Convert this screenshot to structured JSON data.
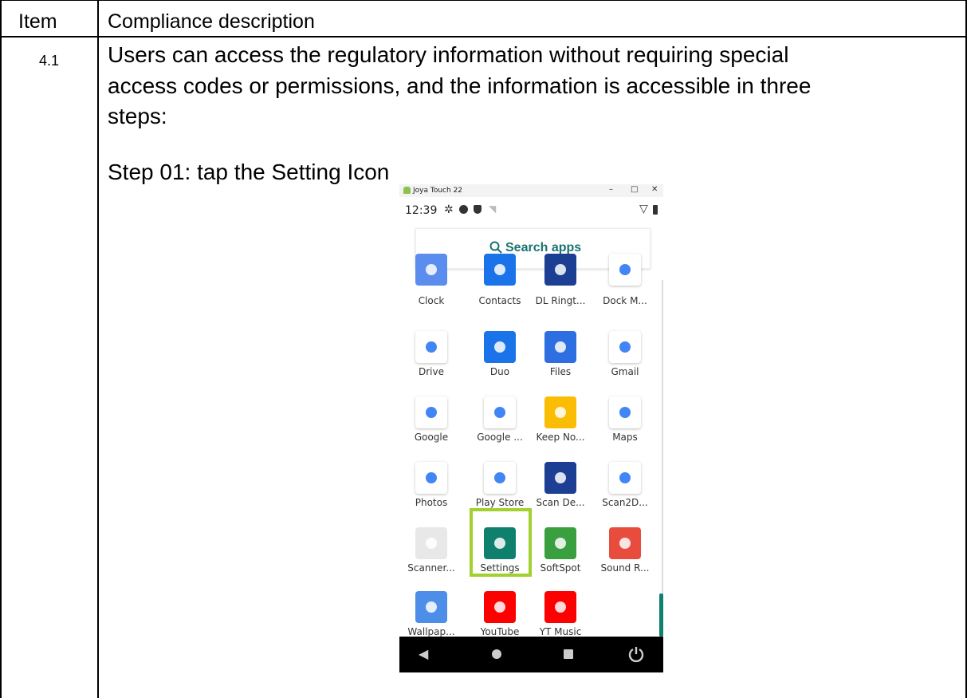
{
  "table": {
    "header_item": "Item",
    "header_desc": "Compliance description",
    "row_item": "4.1",
    "row_line1": "Users can access the regulatory information without requiring special",
    "row_line2": "access codes or permissions, and  the information is accessible in  three",
    "row_line3": "steps:",
    "step_text": "Step 01:  tap the Setting Icon"
  },
  "phone": {
    "window_title": "Joya Touch 22",
    "time": "12:39",
    "search_label": "Search apps",
    "apps": [
      {
        "label": "Clock",
        "color": "#5b8def"
      },
      {
        "label": "Contacts",
        "color": "#1a73e8"
      },
      {
        "label": "DL Ringt...",
        "color": "#1c3f94"
      },
      {
        "label": "Dock M...",
        "color": "#ffffff"
      },
      {
        "label": "Drive",
        "color": "#ffffff"
      },
      {
        "label": "Duo",
        "color": "#1a73e8"
      },
      {
        "label": "Files",
        "color": "#2d6fe0"
      },
      {
        "label": "Gmail",
        "color": "#ffffff"
      },
      {
        "label": "Google",
        "color": "#ffffff"
      },
      {
        "label": "Google ...",
        "color": "#ffffff"
      },
      {
        "label": "Keep No...",
        "color": "#fbbc04"
      },
      {
        "label": "Maps",
        "color": "#ffffff"
      },
      {
        "label": "Photos",
        "color": "#ffffff"
      },
      {
        "label": "Play Store",
        "color": "#ffffff"
      },
      {
        "label": "Scan De...",
        "color": "#1c3f94"
      },
      {
        "label": "Scan2D...",
        "color": "#ffffff"
      },
      {
        "label": "Scanner...",
        "color": "#e8e8e8"
      },
      {
        "label": "Settings",
        "color": "#0f7f6e"
      },
      {
        "label": "SoftSpot",
        "color": "#3a9f3f"
      },
      {
        "label": "Sound R...",
        "color": "#e84c3d"
      },
      {
        "label": "Wallpap...",
        "color": "#4d8fe8"
      },
      {
        "label": "YouTube",
        "color": "#ff0000"
      },
      {
        "label": "YT Music",
        "color": "#ff0000"
      }
    ]
  }
}
